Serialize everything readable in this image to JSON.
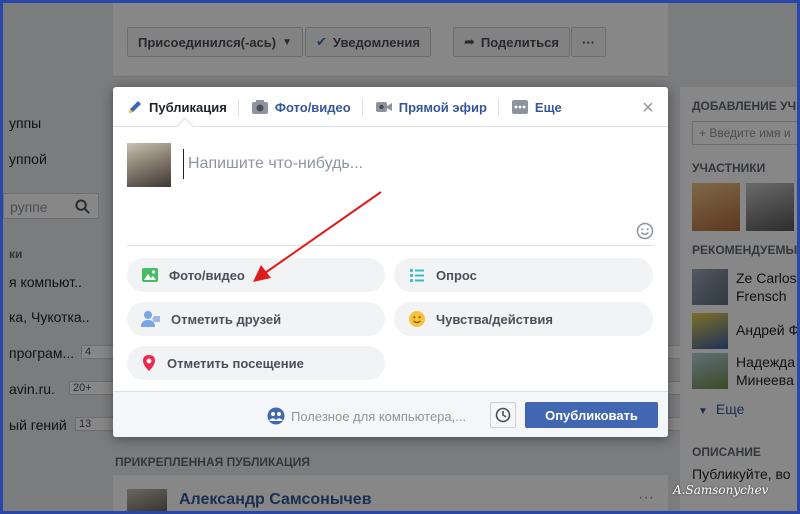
{
  "background": {
    "action_buttons": {
      "joined_label": "Присоединился(-ась)",
      "notifications_label": "Уведомления",
      "share_label": "Поделиться",
      "more_label": "···"
    },
    "left_sidebar": {
      "items": [
        {
          "label": "уппы"
        },
        {
          "label": "уппой"
        }
      ],
      "search_placeholder": "руппе",
      "section_head": "ки",
      "groups": [
        {
          "label": "я компьют..",
          "badge": ""
        },
        {
          "label": "ка, Чукотка..",
          "badge": ""
        },
        {
          "label": "програм...",
          "badge": "4"
        },
        {
          "label": "avin.ru.",
          "badge": "20+"
        },
        {
          "label": "ый гений",
          "badge": "13"
        }
      ]
    },
    "right_sidebar": {
      "add_members_head": "ДОБАВЛЕНИЕ УЧ",
      "add_members_placeholder": "+ Введите имя и",
      "members_head": "УЧАСТНИКИ",
      "recommended_head": "РЕКОМЕНДУЕМЫ",
      "recommended": [
        {
          "line1": "Ze Carlos",
          "line2": "Frensch"
        },
        {
          "line1": "Андрей Ф",
          "line2": ""
        },
        {
          "line1": "Надежда",
          "line2": "Минеева"
        }
      ],
      "more_label": "Еще",
      "description_head": "ОПИСАНИЕ",
      "description_text": "Публикуйте, во"
    },
    "pinned_label": "ПРИКРЕПЛЕННАЯ ПУБЛИКАЦИЯ",
    "pinned_author": "Александр Самсонычев"
  },
  "modal": {
    "tabs": [
      {
        "label": "Публикация",
        "icon": "pencil-icon"
      },
      {
        "label": "Фото/видео",
        "icon": "camera-icon"
      },
      {
        "label": "Прямой эфир",
        "icon": "video-camera-icon"
      },
      {
        "label": "Еще",
        "icon": "more-icon"
      }
    ],
    "composer_placeholder": "Напишите что-нибудь...",
    "options": [
      {
        "label": "Фото/видео",
        "icon": "photo-icon"
      },
      {
        "label": "Опрос",
        "icon": "poll-icon"
      },
      {
        "label": "Отметить друзей",
        "icon": "tag-friends-icon"
      },
      {
        "label": "Чувства/действия",
        "icon": "feelings-icon"
      },
      {
        "label": "Отметить посещение",
        "icon": "location-pin-icon"
      }
    ],
    "audience_label": "Полезное для компьютера,...",
    "publish_label": "Опубликовать"
  },
  "watermark": "A.Samsonychev",
  "colors": {
    "accent": "#4267b2",
    "link": "#365899",
    "arrow": "#e01b1b",
    "frame": "#2b45a8"
  }
}
